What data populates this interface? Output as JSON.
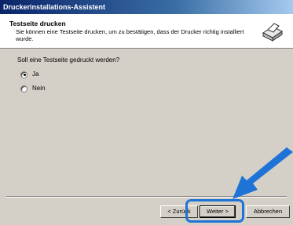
{
  "window": {
    "title": "Druckerinstallations-Assistent"
  },
  "header": {
    "title": "Testseite drucken",
    "description": "Sie können eine Testseite drucken, um zu bestätigen, dass der Drucker richtig installiert wurde."
  },
  "content": {
    "question": "Soll eine Testseite gedruckt werden?",
    "options": [
      {
        "label": "Ja",
        "checked": true
      },
      {
        "label": "Nein",
        "checked": false
      }
    ]
  },
  "buttons": {
    "back": "< Zurück",
    "next": "Weiter >",
    "cancel": "Abbrechen"
  },
  "colors": {
    "title_bar": "#0a246a",
    "highlight": "#1e73d7"
  }
}
